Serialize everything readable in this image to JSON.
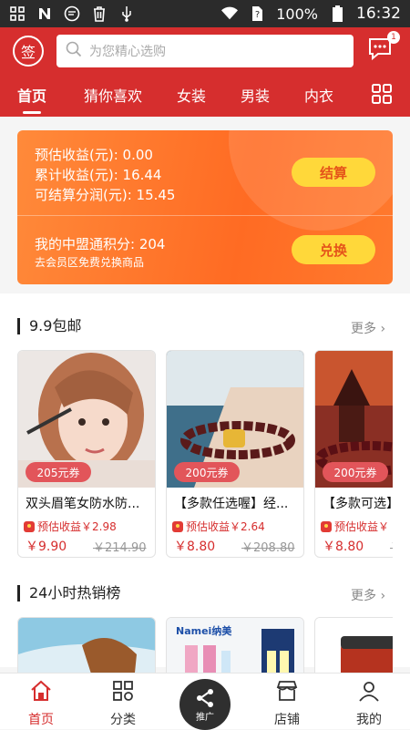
{
  "status_bar": {
    "battery": "100%",
    "time": "16:32"
  },
  "header": {
    "sign_label": "签",
    "search_placeholder": "为您精心选购",
    "message_badge": "1",
    "tabs": [
      "首页",
      "猜你喜欢",
      "女装",
      "男装",
      "内衣"
    ]
  },
  "earnings": {
    "estimated": "预估收益(元): 0.00",
    "cumulative": "累计收益(元): 16.44",
    "settleable": "可结算分润(元): 15.45",
    "settle_button": "结算",
    "points": "我的中盟通积分: 204",
    "points_hint": "去会员区免费兑换商品",
    "exchange_button": "兑换"
  },
  "section1": {
    "title": "9.9包邮",
    "more": "更多",
    "products": [
      {
        "coupon": "205元券",
        "name": "双头眉笔女防水防...",
        "est": "预估收益￥2.98",
        "price": "￥9.90",
        "orig": "￥214.90"
      },
      {
        "coupon": "200元券",
        "name": "【多款任选喔】经...",
        "est": "预估收益￥2.64",
        "price": "￥8.80",
        "orig": "￥208.80"
      },
      {
        "coupon": "200元券",
        "name": "【多款可选】",
        "est": "预估收益￥",
        "price": "￥8.80",
        "orig": "￥"
      }
    ]
  },
  "section2": {
    "title": "24小时热销榜",
    "more": "更多",
    "brand_text": "Namei纳美"
  },
  "bottom_nav": {
    "home": "首页",
    "category": "分类",
    "promote": "推广",
    "store": "店铺",
    "mine": "我的"
  }
}
